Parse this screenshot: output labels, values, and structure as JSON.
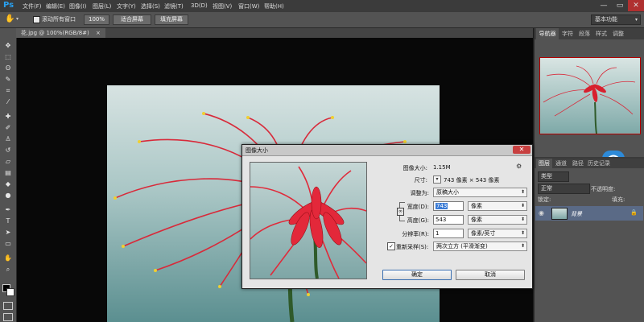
{
  "app": {
    "logo": "Ps"
  },
  "menu": [
    "文件(F)",
    "编辑(E)",
    "图像(I)",
    "图层(L)",
    "文字(Y)",
    "选择(S)",
    "滤镜(T)",
    "3D(D)",
    "视图(V)",
    "窗口(W)",
    "帮助(H)"
  ],
  "window_controls": {
    "minimize": "—",
    "restore": "▭",
    "close": "✕"
  },
  "options_bar": {
    "scroll_all_label": "滚动所有窗口",
    "zoom_100": "100%",
    "fit_screen": "适合屏幕",
    "fill_screen": "填充屏幕",
    "workspace": "基本功能"
  },
  "document_tab": {
    "title": "花.jpg @ 100%(RGB/8#)",
    "close": "×"
  },
  "tools": [
    "move-icon",
    "marquee-icon",
    "lasso-icon",
    "quick-select-icon",
    "crop-icon",
    "eyedropper-icon",
    "healing-icon",
    "brush-icon",
    "stamp-icon",
    "history-brush-icon",
    "eraser-icon",
    "gradient-icon",
    "blur-icon",
    "dodge-icon",
    "pen-icon",
    "type-icon",
    "path-select-icon",
    "shape-icon",
    "hand-icon",
    "zoom-icon"
  ],
  "panels": {
    "top_tabs": [
      "导航器",
      "字符",
      "段落",
      "样式",
      "调整"
    ],
    "bottom_tabs": [
      "图层",
      "通道",
      "路径",
      "历史记录"
    ],
    "kind_filter": "类型",
    "blend_mode": "正常",
    "opacity_label": "不透明度:",
    "lock_label": "锁定:",
    "fill_label": "填充:",
    "layer_name": "背景"
  },
  "dialog": {
    "title": "图像大小",
    "close": "✕",
    "image_size_label": "图像大小:",
    "image_size_value": "1.15M",
    "dimensions_label": "尺寸:",
    "dimensions_value": "743 像素 × 543 像素",
    "resize_to_label": "调整为:",
    "resize_to_value": "原稿大小",
    "width_label": "宽度(D):",
    "width_value": "743",
    "width_unit": "像素",
    "height_label": "高度(G):",
    "height_value": "543",
    "height_unit": "像素",
    "resolution_label": "分辨率(R):",
    "resolution_value": "1",
    "resolution_unit": "像素/英寸",
    "resample_label": "重新采样(S):",
    "resample_value": "两次立方 (平滑渐变)",
    "ok": "确定",
    "cancel": "取消"
  }
}
